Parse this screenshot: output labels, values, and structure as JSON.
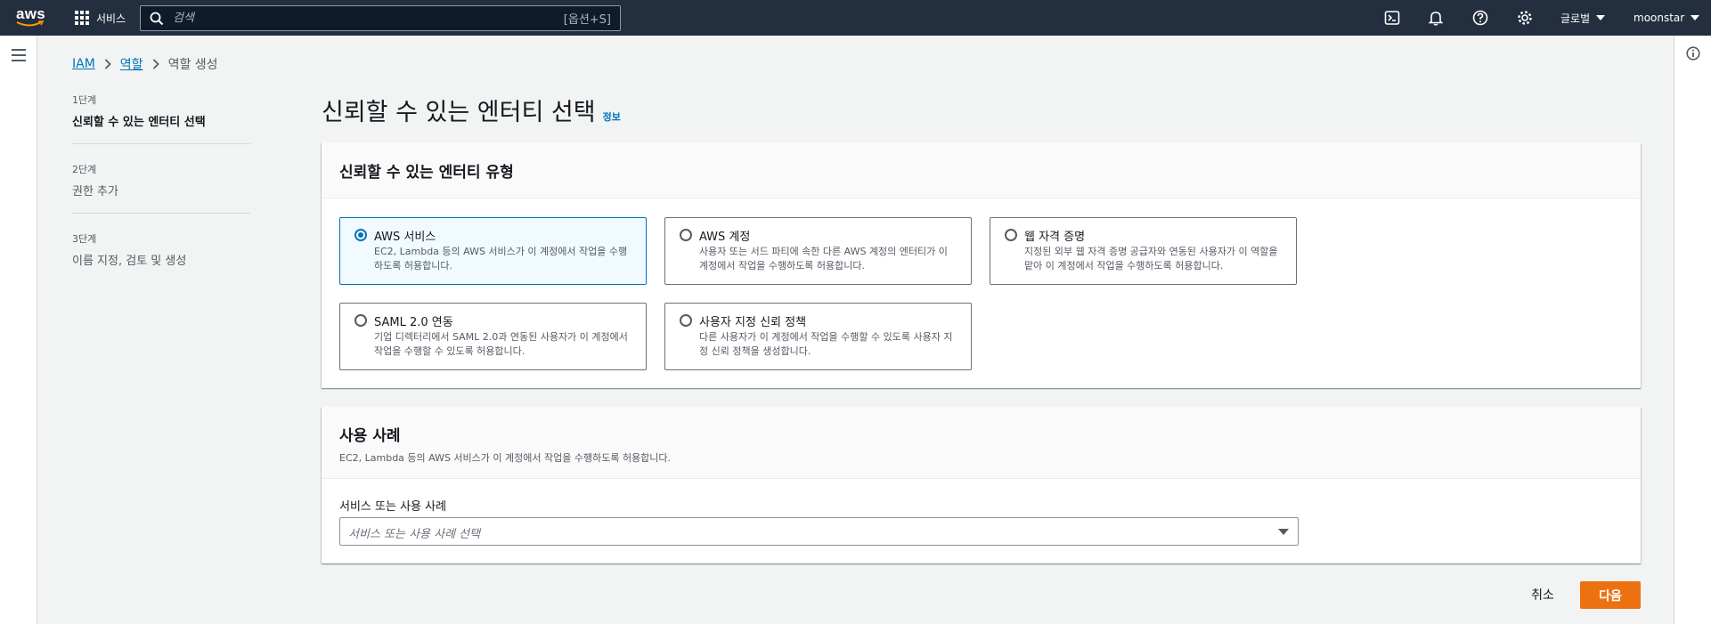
{
  "topnav": {
    "logo_text": "aws",
    "services_label": "서비스",
    "search_placeholder": "검색",
    "search_hint": "[옵션+S]",
    "region_label": "글로벌",
    "account_label": "moonstar"
  },
  "breadcrumb": {
    "items": [
      "IAM",
      "역할"
    ],
    "current": "역할 생성"
  },
  "steps": [
    {
      "num": "1단계",
      "name": "신뢰할 수 있는 엔터티 선택"
    },
    {
      "num": "2단계",
      "name": "권한 추가"
    },
    {
      "num": "3단계",
      "name": "이름 지정, 검토 및 생성"
    }
  ],
  "page": {
    "title": "신뢰할 수 있는 엔터티 선택",
    "info_link": "정보"
  },
  "entity_panel": {
    "title": "신뢰할 수 있는 엔터티 유형",
    "options": [
      {
        "title": "AWS 서비스",
        "desc": "EC2, Lambda 등의 AWS 서비스가 이 계정에서 작업을 수행하도록 허용합니다."
      },
      {
        "title": "AWS 계정",
        "desc": "사용자 또는 서드 파티에 속한 다른 AWS 계정의 엔터티가 이 계정에서 작업을 수행하도록 허용합니다."
      },
      {
        "title": "웹 자격 증명",
        "desc": "지정된 외부 웹 자격 증명 공급자와 연동된 사용자가 이 역할을 맡아 이 계정에서 작업을 수행하도록 허용합니다."
      },
      {
        "title": "SAML 2.0 연동",
        "desc": "기업 디렉터리에서 SAML 2.0과 연동된 사용자가 이 계정에서 작업을 수행할 수 있도록 허용합니다."
      },
      {
        "title": "사용자 지정 신뢰 정책",
        "desc": "다른 사용자가 이 계정에서 작업을 수행할 수 있도록 사용자 지정 신뢰 정책을 생성합니다."
      }
    ]
  },
  "use_case_panel": {
    "title": "사용 사례",
    "desc": "EC2, Lambda 등의 AWS 서비스가 이 계정에서 작업을 수행하도록 허용합니다.",
    "field_label": "서비스 또는 사용 사례",
    "select_placeholder": "서비스 또는 사용 사례 선택"
  },
  "actions": {
    "cancel": "취소",
    "next": "다음"
  },
  "colors": {
    "nav_bg": "#232f3e",
    "link": "#0073bb",
    "primary_button": "#ec7211",
    "page_bg": "#f2f3f3"
  },
  "icons": [
    "grid-icon",
    "search-icon",
    "cloudshell-icon",
    "bell-icon",
    "help-icon",
    "gear-icon",
    "menu-icon",
    "info-icon"
  ]
}
